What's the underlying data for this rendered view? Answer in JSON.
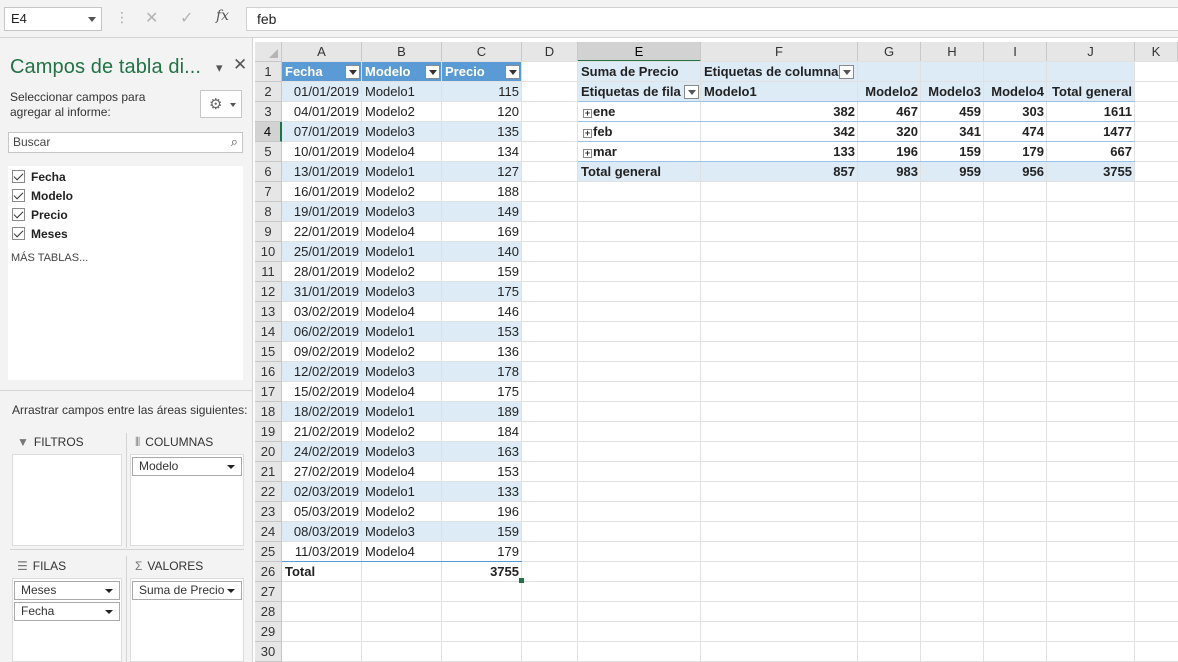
{
  "formula_bar": {
    "name_box": "E4",
    "content": "feb"
  },
  "pane": {
    "title": "Campos de tabla di...",
    "subtitle": "Seleccionar campos para agregar al informe:",
    "search_placeholder": "Buscar",
    "fields": [
      "Fecha",
      "Modelo",
      "Precio",
      "Meses"
    ],
    "more_tables": "MÁS TABLAS...",
    "drag_hint": "Arrastrar campos entre las áreas siguientes:",
    "areas": {
      "filters": "FILTROS",
      "columns": "COLUMNAS",
      "rows": "FILAS",
      "values": "VALORES"
    },
    "columns_chips": [
      "Modelo"
    ],
    "rows_chips": [
      "Meses",
      "Fecha"
    ],
    "values_chips": [
      "Suma de Precio"
    ]
  },
  "grid": {
    "columns": [
      "A",
      "B",
      "C",
      "D",
      "E",
      "F",
      "G",
      "H",
      "I",
      "J",
      "K"
    ],
    "rows": [
      "1",
      "2",
      "3",
      "4",
      "5",
      "6",
      "7",
      "8",
      "9",
      "10",
      "11",
      "12",
      "13",
      "14",
      "15",
      "16",
      "17",
      "18",
      "19",
      "20",
      "21",
      "22",
      "23",
      "24",
      "25",
      "26",
      "27",
      "28",
      "29",
      "30"
    ],
    "table_headers": [
      "Fecha",
      "Modelo",
      "Precio"
    ],
    "table_rows": [
      [
        "01/01/2019",
        "Modelo1",
        "115"
      ],
      [
        "04/01/2019",
        "Modelo2",
        "120"
      ],
      [
        "07/01/2019",
        "Modelo3",
        "135"
      ],
      [
        "10/01/2019",
        "Modelo4",
        "134"
      ],
      [
        "13/01/2019",
        "Modelo1",
        "127"
      ],
      [
        "16/01/2019",
        "Modelo2",
        "188"
      ],
      [
        "19/01/2019",
        "Modelo3",
        "149"
      ],
      [
        "22/01/2019",
        "Modelo4",
        "169"
      ],
      [
        "25/01/2019",
        "Modelo1",
        "140"
      ],
      [
        "28/01/2019",
        "Modelo2",
        "159"
      ],
      [
        "31/01/2019",
        "Modelo3",
        "175"
      ],
      [
        "03/02/2019",
        "Modelo4",
        "146"
      ],
      [
        "06/02/2019",
        "Modelo1",
        "153"
      ],
      [
        "09/02/2019",
        "Modelo2",
        "136"
      ],
      [
        "12/02/2019",
        "Modelo3",
        "178"
      ],
      [
        "15/02/2019",
        "Modelo4",
        "175"
      ],
      [
        "18/02/2019",
        "Modelo1",
        "189"
      ],
      [
        "21/02/2019",
        "Modelo2",
        "184"
      ],
      [
        "24/02/2019",
        "Modelo3",
        "163"
      ],
      [
        "27/02/2019",
        "Modelo4",
        "153"
      ],
      [
        "02/03/2019",
        "Modelo1",
        "133"
      ],
      [
        "05/03/2019",
        "Modelo2",
        "196"
      ],
      [
        "08/03/2019",
        "Modelo3",
        "159"
      ],
      [
        "11/03/2019",
        "Modelo4",
        "179"
      ]
    ],
    "table_total_label": "Total",
    "table_total_value": "3755"
  },
  "pivot": {
    "value_label": "Suma de Precio",
    "col_labels_caption": "Etiquetas de columna",
    "row_labels_caption": "Etiquetas de fila",
    "col_headers": [
      "Modelo1",
      "Modelo2",
      "Modelo3",
      "Modelo4",
      "Total general"
    ],
    "rows": [
      {
        "label": "ene",
        "values": [
          "382",
          "467",
          "459",
          "303",
          "1611"
        ]
      },
      {
        "label": "feb",
        "values": [
          "342",
          "320",
          "341",
          "474",
          "1477"
        ]
      },
      {
        "label": "mar",
        "values": [
          "133",
          "196",
          "159",
          "179",
          "667"
        ]
      }
    ],
    "grand_total_label": "Total general",
    "grand_total_values": [
      "857",
      "983",
      "959",
      "956",
      "3755"
    ]
  },
  "colors": {
    "accent": "#217346",
    "table_header": "#5b9bd5",
    "band": "#ddebf7"
  }
}
